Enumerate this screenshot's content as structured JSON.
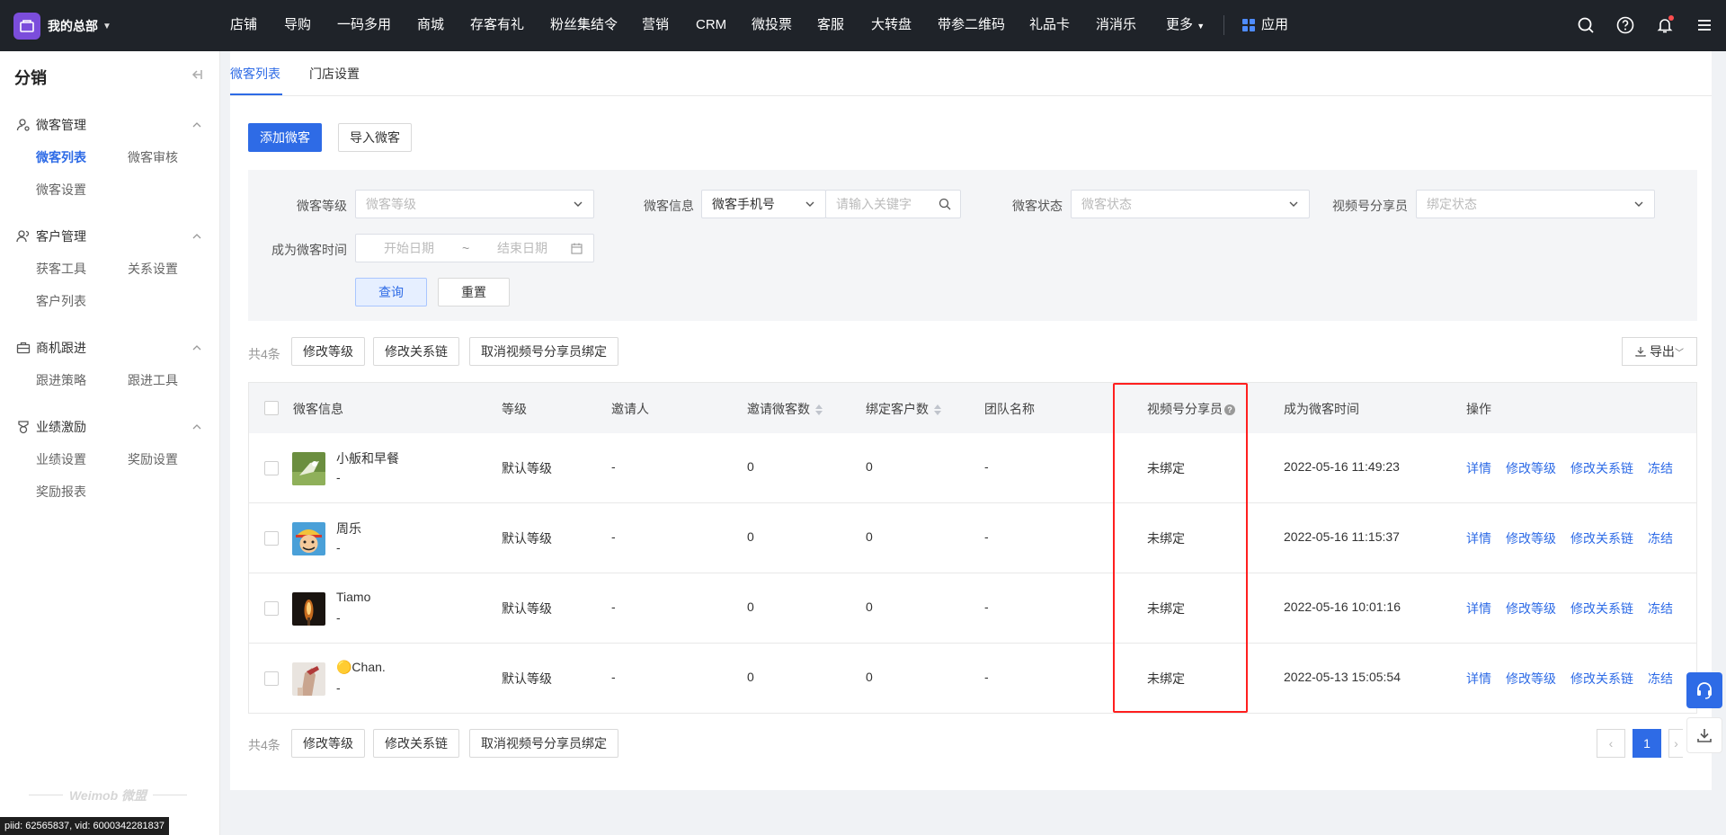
{
  "topbar": {
    "brand": "我的总部",
    "nav": [
      "店铺",
      "导购",
      "一码多用",
      "商城",
      "存客有礼",
      "粉丝集结令",
      "营销",
      "CRM",
      "微投票",
      "客服",
      "大转盘",
      "带参二维码",
      "礼品卡",
      "消消乐",
      "更多"
    ],
    "app_label": "应用"
  },
  "sidebar": {
    "title": "分销",
    "groups": [
      {
        "label": "微客管理",
        "icon": "user-settings-icon",
        "items": [
          "微客列表",
          "微客审核",
          "微客设置"
        ]
      },
      {
        "label": "客户管理",
        "icon": "users-icon",
        "items": [
          "获客工具",
          "关系设置",
          "客户列表"
        ]
      },
      {
        "label": "商机跟进",
        "icon": "briefcase-icon",
        "items": [
          "跟进策略",
          "跟进工具"
        ]
      },
      {
        "label": "业绩激励",
        "icon": "medal-icon",
        "items": [
          "业绩设置",
          "奖励设置",
          "奖励报表"
        ]
      }
    ],
    "footer": "Weimob 微盟",
    "debug": "piid: 62565837, vid: 6000342281837"
  },
  "tabs": [
    "微客列表",
    "门店设置"
  ],
  "actions": {
    "add": "添加微客",
    "import": "导入微客"
  },
  "filters": {
    "level_label": "微客等级",
    "level_placeholder": "微客等级",
    "info_label": "微客信息",
    "info_type": "微客手机号",
    "keyword_placeholder": "请输入关键字",
    "status_label": "微客状态",
    "status_placeholder": "微客状态",
    "sharer_label": "视频号分享员",
    "sharer_placeholder": "绑定状态",
    "time_label": "成为微客时间",
    "start_placeholder": "开始日期",
    "date_sep": "~",
    "end_placeholder": "结束日期",
    "query": "查询",
    "reset": "重置"
  },
  "bulk": {
    "count": "共4条",
    "change_level": "修改等级",
    "change_chain": "修改关系链",
    "unbind": "取消视频号分享员绑定",
    "export": "导出"
  },
  "table": {
    "headers": [
      "微客信息",
      "等级",
      "邀请人",
      "邀请微客数",
      "绑定客户数",
      "团队名称",
      "视频号分享员",
      "成为微客时间",
      "操作"
    ],
    "rows": [
      {
        "name": "小舨和早餐",
        "sub": "-",
        "level": "默认等级",
        "inviter": "-",
        "invited": "0",
        "bound": "0",
        "team": "-",
        "sharer": "未绑定",
        "time": "2022-05-16 11:49:23"
      },
      {
        "name": "周乐",
        "sub": "-",
        "level": "默认等级",
        "inviter": "-",
        "invited": "0",
        "bound": "0",
        "team": "-",
        "sharer": "未绑定",
        "time": "2022-05-16 11:15:37"
      },
      {
        "name": "Tiamo",
        "sub": "-",
        "level": "默认等级",
        "inviter": "-",
        "invited": "0",
        "bound": "0",
        "team": "-",
        "sharer": "未绑定",
        "time": "2022-05-16 10:01:16"
      },
      {
        "name": "🟡Chan.",
        "sub": "-",
        "level": "默认等级",
        "inviter": "-",
        "invited": "0",
        "bound": "0",
        "team": "-",
        "sharer": "未绑定",
        "time": "2022-05-13 15:05:54"
      }
    ],
    "ops": [
      "详情",
      "修改等级",
      "修改关系链",
      "冻结"
    ]
  },
  "pagination": {
    "prev": "‹",
    "current": "1",
    "next": "›"
  },
  "colors": {
    "primary": "#2e6be6",
    "topbar": "#1f2329",
    "highlight": "#ff1f1f"
  }
}
